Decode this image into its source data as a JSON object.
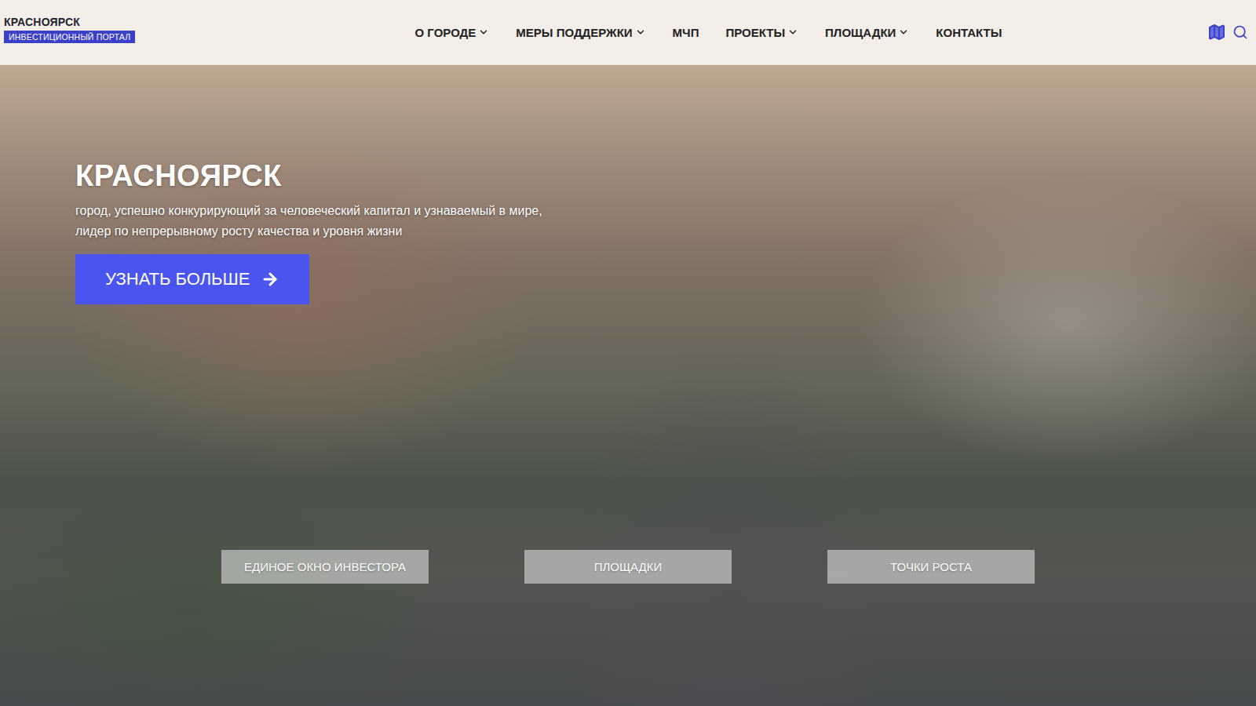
{
  "header": {
    "logo": {
      "title": "КРАСНОЯРСК",
      "badge": "ИНВЕСТИЦИОННЫЙ ПОРТАЛ"
    },
    "nav": [
      {
        "label": "О ГОРОДЕ",
        "has_menu": true
      },
      {
        "label": "МЕРЫ ПОДДЕРЖКИ",
        "has_menu": true
      },
      {
        "label": "МЧП",
        "has_menu": false
      },
      {
        "label": "ПРОЕКТЫ",
        "has_menu": true
      },
      {
        "label": "ПЛОЩАДКИ",
        "has_menu": true
      },
      {
        "label": "КОНТАКТЫ",
        "has_menu": false
      }
    ]
  },
  "hero": {
    "title": "КРАСНОЯРСК",
    "subtitle": [
      "город, успешно конкурирующий за человеческий капитал и узнаваемый в мире,",
      "лидер по непрерывному росту качества и уровня жизни"
    ],
    "cta": "УЗНАТЬ БОЛЬШЕ",
    "quick_links": [
      "ЕДИНОЕ ОКНО ИНВЕСТОРА",
      "ПЛОЩАДКИ",
      "ТОЧКИ РОСТА"
    ]
  }
}
